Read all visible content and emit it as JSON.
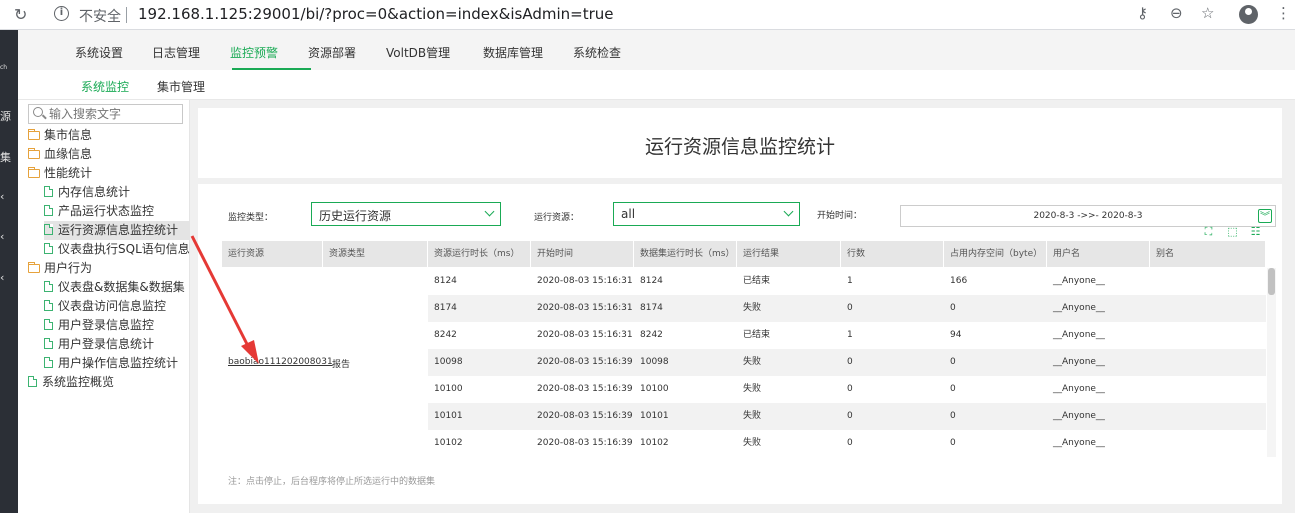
{
  "browser": {
    "insecure_label": "不安全",
    "url": "192.168.1.125:29001/bi/?proc=0&action=index&isAdmin=true"
  },
  "left_strip": {
    "chars": [
      "ch",
      "源",
      "集",
      "‹",
      "‹",
      "‹"
    ]
  },
  "top_nav": {
    "tabs": [
      "系统设置",
      "日志管理",
      "监控预警",
      "资源部署",
      "VoltDB管理",
      "数据库管理",
      "系统检查"
    ],
    "active_index": 2
  },
  "sub_nav": {
    "tabs": [
      "系统监控",
      "集市管理"
    ],
    "active_index": 0
  },
  "sidebar": {
    "search_placeholder": "输入搜索文字",
    "items": [
      {
        "label": "集市信息",
        "type": "folder",
        "level": 0
      },
      {
        "label": "血缘信息",
        "type": "folder",
        "level": 0
      },
      {
        "label": "性能统计",
        "type": "folder-open",
        "level": 0
      },
      {
        "label": "内存信息统计",
        "type": "doc",
        "level": 1
      },
      {
        "label": "产品运行状态监控",
        "type": "doc",
        "level": 1
      },
      {
        "label": "运行资源信息监控统计",
        "type": "doc",
        "level": 1,
        "selected": true
      },
      {
        "label": "仪表盘执行SQL语句信息",
        "type": "doc",
        "level": 1
      },
      {
        "label": "用户行为",
        "type": "folder-open",
        "level": 0
      },
      {
        "label": "仪表盘&数据集&数据集",
        "type": "doc",
        "level": 1
      },
      {
        "label": "仪表盘访问信息监控",
        "type": "doc",
        "level": 1
      },
      {
        "label": "用户登录信息监控",
        "type": "doc",
        "level": 1
      },
      {
        "label": "用户登录信息统计",
        "type": "doc",
        "level": 1
      },
      {
        "label": "用户操作信息监控统计",
        "type": "doc",
        "level": 1
      },
      {
        "label": "系统监控概览",
        "type": "doc",
        "level": 0
      }
    ]
  },
  "page": {
    "title": "运行资源信息监控统计"
  },
  "filters": {
    "monitor_type_label": "监控类型：",
    "monitor_type_value": "历史运行资源",
    "resource_label": "运行资源：",
    "resource_value": "all",
    "start_time_label": "开始时间：",
    "date_range": "2020-8-3 ->>- 2020-8-3"
  },
  "table": {
    "columns": [
      "运行资源",
      "资源类型",
      "资源运行时长（ms）",
      "开始时间",
      "数据集运行时长（ms）",
      "运行结果",
      "行数",
      "占用内存空间（byte）",
      "用户名",
      "别名"
    ],
    "merged_resource": "baobiao111202008031",
    "merged_type": "报告",
    "rows": [
      [
        "8124",
        "2020-08-03 15:16:31",
        "8124",
        "已结束",
        "1",
        "166",
        "__Anyone__",
        ""
      ],
      [
        "8174",
        "2020-08-03 15:16:31",
        "8174",
        "失败",
        "0",
        "0",
        "__Anyone__",
        ""
      ],
      [
        "8242",
        "2020-08-03 15:16:31",
        "8242",
        "已结束",
        "1",
        "94",
        "__Anyone__",
        ""
      ],
      [
        "10098",
        "2020-08-03 15:16:39",
        "10098",
        "失败",
        "0",
        "0",
        "__Anyone__",
        ""
      ],
      [
        "10100",
        "2020-08-03 15:16:39",
        "10100",
        "失败",
        "0",
        "0",
        "__Anyone__",
        ""
      ],
      [
        "10101",
        "2020-08-03 15:16:39",
        "10101",
        "失败",
        "0",
        "0",
        "__Anyone__",
        ""
      ],
      [
        "10102",
        "2020-08-03 15:16:39",
        "10102",
        "失败",
        "0",
        "0",
        "__Anyone__",
        ""
      ]
    ]
  },
  "note": "注：点击停止，后台程序将停止所选运行中的数据集",
  "colors": {
    "accent": "#1aaa55",
    "arrow": "#e53935"
  }
}
